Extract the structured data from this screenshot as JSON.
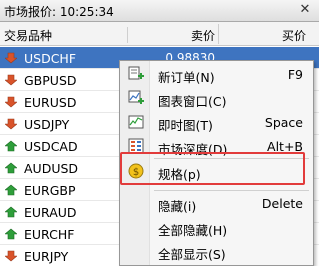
{
  "window": {
    "title": "市场报价: 10:25:34"
  },
  "table": {
    "headers": {
      "symbol": "交易品种",
      "bid": "卖价",
      "ask": "买价"
    },
    "rows": [
      {
        "symbol": "USDCHF",
        "bid": "0.98830",
        "direction": "down",
        "selected": true
      },
      {
        "symbol": "GBPUSD",
        "bid": "",
        "direction": "down"
      },
      {
        "symbol": "EURUSD",
        "bid": "",
        "direction": "down"
      },
      {
        "symbol": "USDJPY",
        "bid": "",
        "direction": "down"
      },
      {
        "symbol": "USDCAD",
        "bid": "",
        "direction": "up"
      },
      {
        "symbol": "AUDUSD",
        "bid": "",
        "direction": "up"
      },
      {
        "symbol": "EURGBP",
        "bid": "",
        "direction": "up"
      },
      {
        "symbol": "EURAUD",
        "bid": "",
        "direction": "up"
      },
      {
        "symbol": "EURCHF",
        "bid": "",
        "direction": "up"
      },
      {
        "symbol": "EURJPY",
        "bid": "",
        "direction": "down"
      }
    ]
  },
  "context_menu": {
    "items": [
      {
        "label": "新订单(N)",
        "shortcut": "F9",
        "icon": "new-order-icon"
      },
      {
        "label": "图表窗口(C)",
        "shortcut": "",
        "icon": "chart-window-icon"
      },
      {
        "label": "即时图(T)",
        "shortcut": "Space",
        "icon": "tick-chart-icon"
      },
      {
        "label": "市场深度(D)",
        "shortcut": "Alt+B",
        "icon": "market-depth-icon"
      },
      {
        "label": "规格(p)",
        "shortcut": "",
        "icon": "specification-icon"
      },
      {
        "label": "隐藏(i)",
        "shortcut": "Delete",
        "icon": ""
      },
      {
        "label": "全部隐藏(H)",
        "shortcut": "",
        "icon": ""
      },
      {
        "label": "全部显示(S)",
        "shortcut": "",
        "icon": ""
      }
    ]
  },
  "colors": {
    "selection": "#3e74c0",
    "highlight_box": "#e23b3b",
    "up": "#2e9e3a",
    "down": "#d9532a"
  }
}
